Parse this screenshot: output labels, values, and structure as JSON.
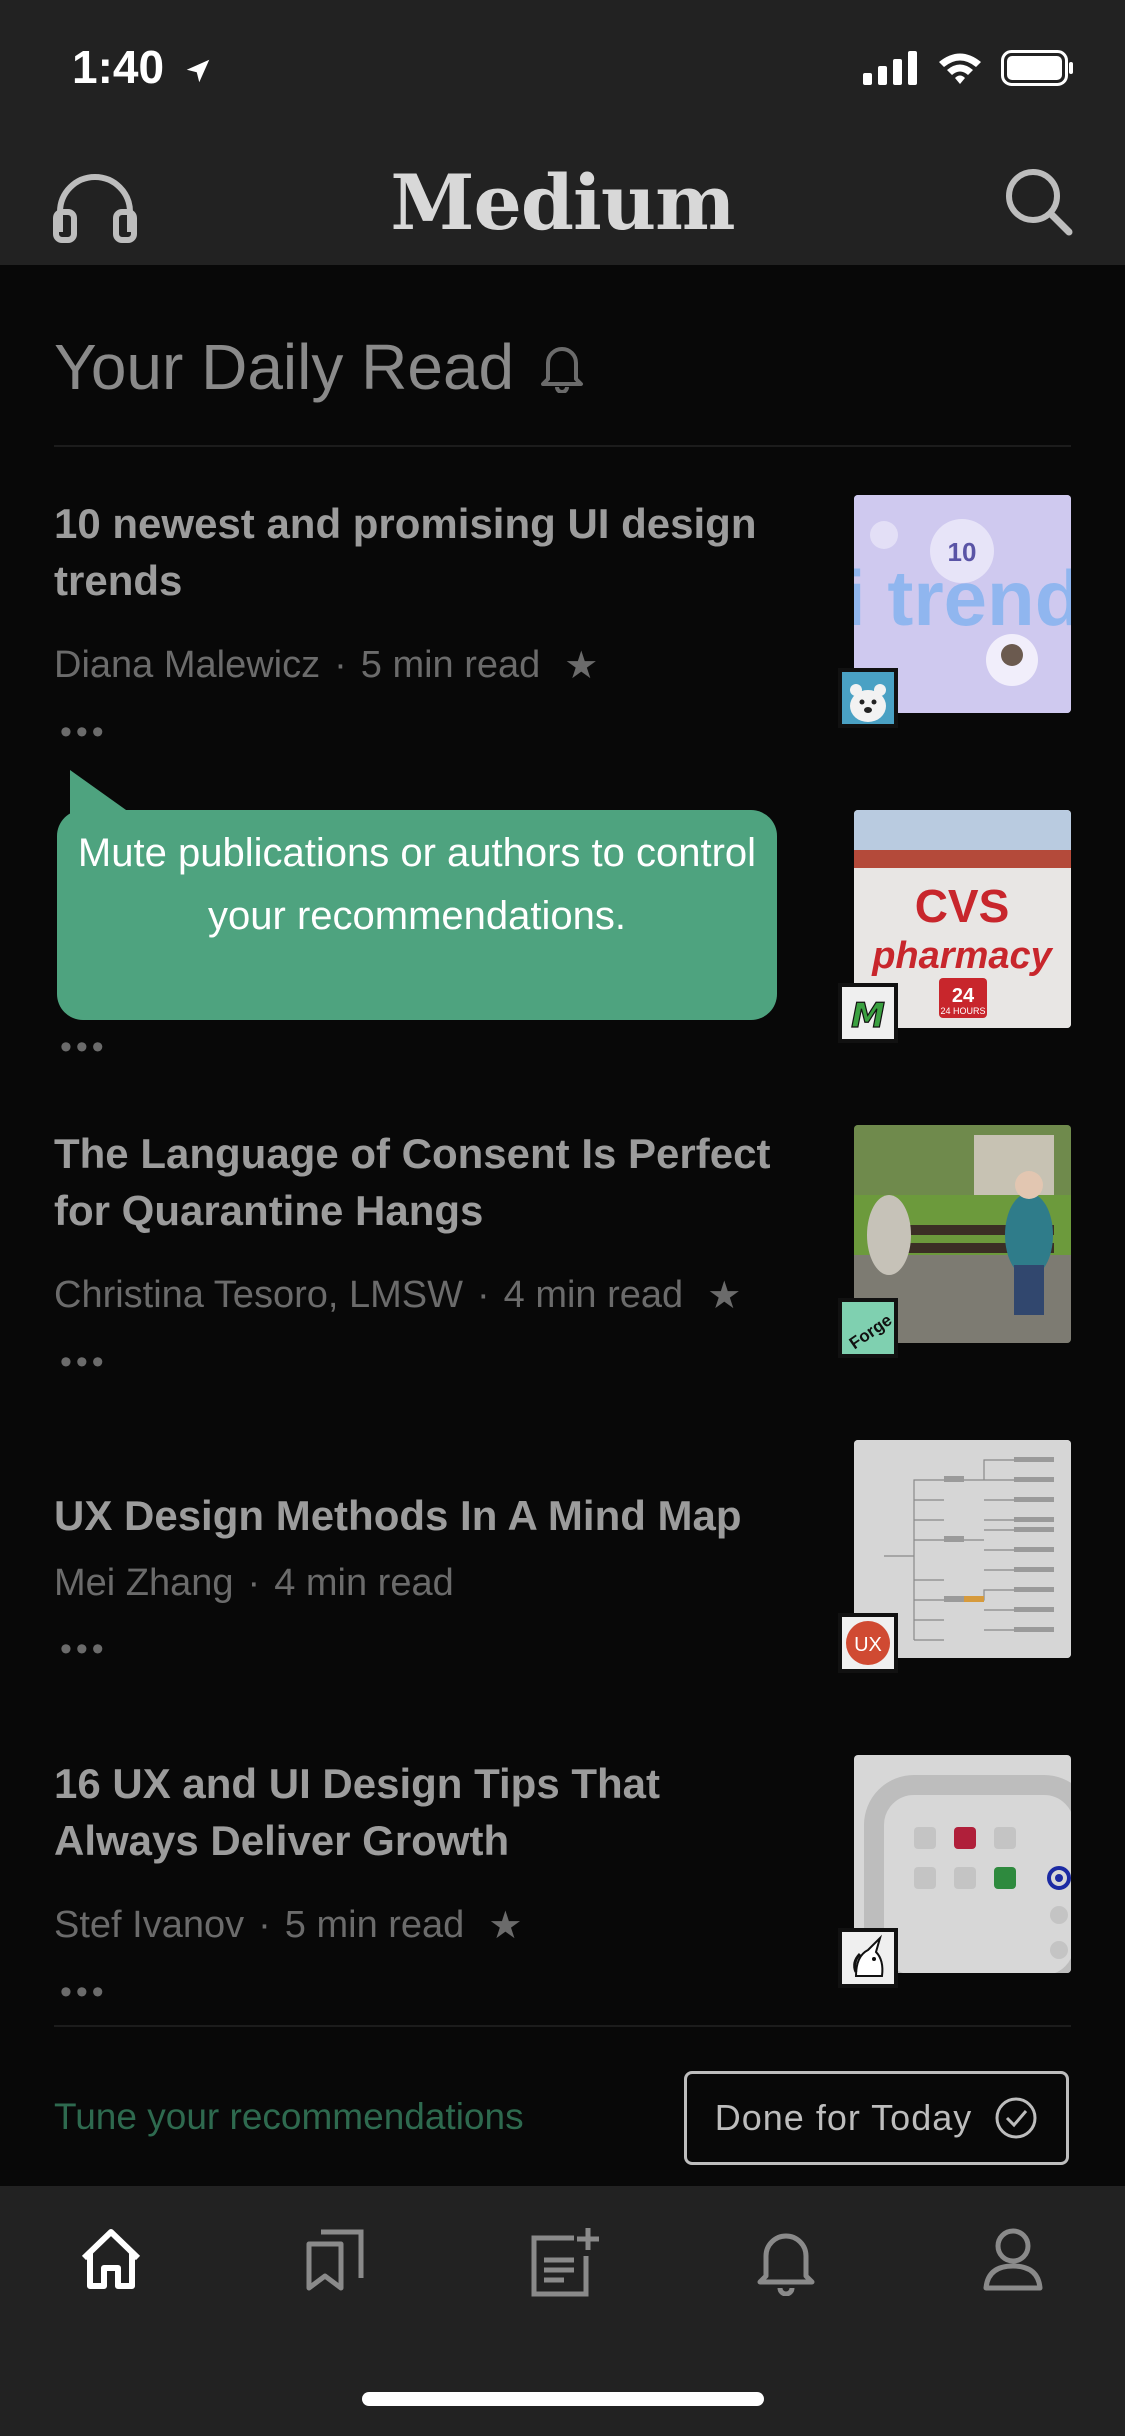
{
  "status": {
    "time": "1:40"
  },
  "nav": {
    "title": "Medium",
    "left_icon": "headphones-icon",
    "right_icon": "search-icon"
  },
  "section": {
    "title": "Your Daily Read",
    "icon": "bell-icon"
  },
  "articles": [
    {
      "title": "10 newest and promising UI design trends",
      "author": "Diana Malewicz",
      "read": "5 min read",
      "star": true,
      "thumb_text": "i trend",
      "thumb_num": "10",
      "badge": "polar-bear-icon"
    },
    {
      "title": "",
      "author": "",
      "read": "",
      "star": false,
      "thumb_text": "CVS pharmacy",
      "thumb_sub": "24 HOURS",
      "badge": "M"
    },
    {
      "title": "The Language of Consent Is Perfect for Quarantine Hangs",
      "author": "Christina Tesoro, LMSW",
      "read": "4 min read",
      "star": true,
      "badge": "Forge"
    },
    {
      "title": "UX Design Methods In A Mind Map",
      "author": "Mei Zhang",
      "read": "4 min read",
      "star": false,
      "badge": "UX"
    },
    {
      "title": "16 UX and UI Design Tips That Always Deliver Growth",
      "author": "Stef Ivanov",
      "read": "5 min read",
      "star": true,
      "badge": "unicorn-icon"
    }
  ],
  "tooltip": {
    "text": "Mute publications or authors to control your recommendations."
  },
  "footer": {
    "tune_label": "Tune your recommendations",
    "done_label": "Done for Today"
  },
  "tabs": [
    "home-icon",
    "bookmarks-icon",
    "new-story-icon",
    "notifications-icon",
    "profile-icon"
  ],
  "colors": {
    "accent_green": "#4ea37f",
    "bar_bg": "#222222",
    "page_bg": "#080808"
  }
}
